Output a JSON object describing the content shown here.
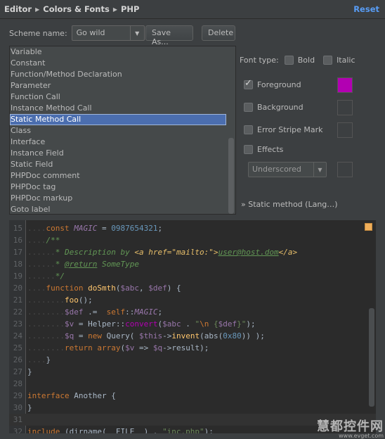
{
  "breadcrumb": {
    "items": [
      "Editor",
      "Colors & Fonts",
      "PHP"
    ],
    "reset_label": "Reset"
  },
  "scheme": {
    "label": "Scheme name:",
    "value": "Go wild",
    "save_as_label": "Save As...",
    "delete_label": "Delete"
  },
  "elements": {
    "items": [
      "Variable",
      "Constant",
      "Function/Method Declaration",
      "Parameter",
      "Function Call",
      "Instance Method Call",
      "Static Method Call",
      "Class",
      "Interface",
      "Instance Field",
      "Static Field",
      "PHPDoc comment",
      "PHPDoc tag",
      "PHPDoc markup",
      "Goto label"
    ],
    "selected": "Static Method Call"
  },
  "options": {
    "font_type_label": "Font type:",
    "bold_label": "Bold",
    "italic_label": "Italic",
    "foreground_label": "Foreground",
    "foreground_checked": true,
    "foreground_color": "#b200b2",
    "background_label": "Background",
    "error_stripe_label": "Error Stripe Mark",
    "effects_label": "Effects",
    "effect_type": "Underscored",
    "inherit_link": "Static method (Lang…)"
  },
  "code": {
    "lines": [
      {
        "n": "15",
        "ws": "....",
        "parts": [
          [
            "kw",
            "const "
          ],
          [
            "cst",
            "MAGIC"
          ],
          [
            "code",
            " = "
          ],
          [
            "num",
            "0987654321"
          ],
          [
            "code",
            ";"
          ]
        ]
      },
      {
        "n": "16",
        "ws": "....",
        "parts": [
          [
            "doc",
            "/**"
          ]
        ]
      },
      {
        "n": "17",
        "ws": "......",
        "parts": [
          [
            "doc",
            "* Description by "
          ],
          [
            "html",
            "<a href=\"mailto:\">"
          ],
          [
            "doctag",
            "user@host.dom"
          ],
          [
            "html",
            "</a>"
          ]
        ]
      },
      {
        "n": "18",
        "ws": "......",
        "parts": [
          [
            "doc",
            "* "
          ],
          [
            "doctag",
            "@return"
          ],
          [
            "doc",
            " SomeType"
          ]
        ]
      },
      {
        "n": "19",
        "ws": "......",
        "parts": [
          [
            "doc",
            "*/"
          ]
        ]
      },
      {
        "n": "20",
        "ws": "....",
        "parts": [
          [
            "kw",
            "function "
          ],
          [
            "fn",
            "doSmth"
          ],
          [
            "code",
            "("
          ],
          [
            "var",
            "$abc"
          ],
          [
            "code",
            ", "
          ],
          [
            "var",
            "$def"
          ],
          [
            "code",
            ") {"
          ]
        ]
      },
      {
        "n": "21",
        "ws": "........",
        "parts": [
          [
            "fn",
            "foo"
          ],
          [
            "code",
            "();"
          ]
        ]
      },
      {
        "n": "22",
        "ws": "........",
        "parts": [
          [
            "var",
            "$def"
          ],
          [
            "code",
            " .=  "
          ],
          [
            "kw",
            "self"
          ],
          [
            "code",
            "::"
          ],
          [
            "cst",
            "MAGIC"
          ],
          [
            "code",
            ";"
          ]
        ]
      },
      {
        "n": "23",
        "ws": "........",
        "parts": [
          [
            "var",
            "$v"
          ],
          [
            "code",
            " = Helper::"
          ],
          [
            "smc",
            "convert"
          ],
          [
            "code",
            "("
          ],
          [
            "var",
            "$abc"
          ],
          [
            "code",
            " . "
          ],
          [
            "str",
            "\""
          ],
          [
            "esc",
            "\\n"
          ],
          [
            "str",
            " {"
          ],
          [
            "var",
            "$def"
          ],
          [
            "str",
            "}\""
          ],
          [
            "code",
            ");"
          ]
        ]
      },
      {
        "n": "24",
        "ws": "........",
        "parts": [
          [
            "var",
            "$q"
          ],
          [
            "code",
            " = "
          ],
          [
            "kw",
            "new"
          ],
          [
            "code",
            " Query( "
          ],
          [
            "var",
            "$this"
          ],
          [
            "code",
            "->"
          ],
          [
            "fn",
            "invent"
          ],
          [
            "code",
            "(abs("
          ],
          [
            "num",
            "0x80"
          ],
          [
            "code",
            ")) );"
          ]
        ]
      },
      {
        "n": "25",
        "ws": "........",
        "parts": [
          [
            "kw",
            "return "
          ],
          [
            "kw",
            "array"
          ],
          [
            "code",
            "("
          ],
          [
            "var",
            "$v"
          ],
          [
            "code",
            " => "
          ],
          [
            "var",
            "$q"
          ],
          [
            "code",
            "->result);"
          ]
        ]
      },
      {
        "n": "26",
        "ws": "....",
        "parts": [
          [
            "code",
            "}"
          ]
        ]
      },
      {
        "n": "27",
        "ws": "",
        "parts": [
          [
            "code",
            "}"
          ]
        ]
      },
      {
        "n": "28",
        "ws": "",
        "parts": []
      },
      {
        "n": "29",
        "ws": "",
        "parts": [
          [
            "kw",
            "interface"
          ],
          [
            "code",
            " Another {"
          ]
        ]
      },
      {
        "n": "30",
        "ws": "",
        "parts": [
          [
            "code",
            "}"
          ]
        ]
      },
      {
        "n": "31",
        "ws": "",
        "parts": []
      },
      {
        "n": "32",
        "ws": "",
        "parts": [
          [
            "kw",
            "include"
          ],
          [
            "code",
            " (dirname(__FILE__) . "
          ],
          [
            "str",
            "\"inc.php\""
          ],
          [
            "code",
            ");"
          ]
        ]
      }
    ]
  },
  "watermark": {
    "line1": "慧都控件网",
    "line2": "www.evget.com"
  }
}
